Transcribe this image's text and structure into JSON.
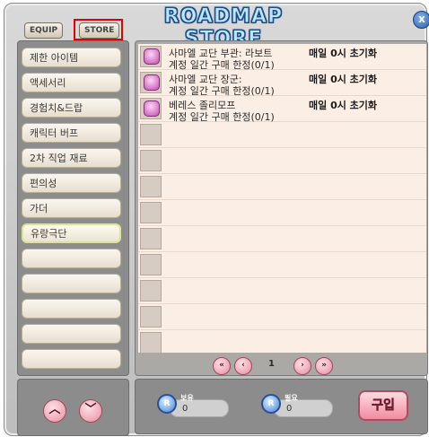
{
  "window": {
    "title": "ROADMAP STORE",
    "close_icon": "x"
  },
  "top_tabs": {
    "equip": "EQUIP",
    "store": "STORE"
  },
  "sidebar": {
    "items": [
      {
        "label": "제한 아이템"
      },
      {
        "label": "액세서리"
      },
      {
        "label": "경험치&드랍"
      },
      {
        "label": "캐릭터 버프"
      },
      {
        "label": "2차 직업 재료"
      },
      {
        "label": "편의성"
      },
      {
        "label": "가더"
      },
      {
        "label": "유랑극단"
      }
    ],
    "up_icon": "︿",
    "down_icon": "﹀"
  },
  "items": [
    {
      "name": "사마엘 교단 부관: 라보트",
      "limit": "계정 일간 구매 한정(0/1)",
      "reset": "매일 0시 초기화"
    },
    {
      "name": "사마엘 교단 장군:",
      "limit": "계정 일간 구매 한정(0/1)",
      "reset": "매일 0시 초기화"
    },
    {
      "name": "베레스 졸리모프",
      "limit": "계정 일간 구매 한정(0/1)",
      "reset": "매일 0시 초기화"
    }
  ],
  "pagination": {
    "first": "«",
    "prev": "‹",
    "page": "1",
    "next": "›",
    "last": "»"
  },
  "currency": {
    "coin_letter": "R",
    "owned_label": "보유",
    "owned_value": "0",
    "required_label": "필요",
    "required_value": "0"
  },
  "buy_label": "구입"
}
